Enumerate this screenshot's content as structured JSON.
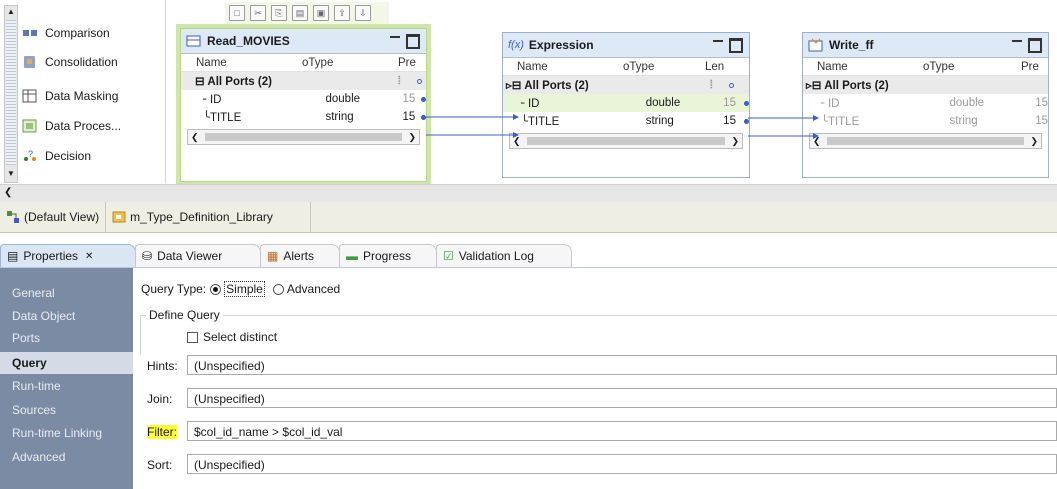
{
  "palette": {
    "items": [
      "Comparison",
      "Consolidation",
      "Data Masking",
      "Data Proces...",
      "Decision"
    ]
  },
  "transforms": {
    "read": {
      "title": "Read_MOVIES",
      "col_name": "Name",
      "col_type": "Type",
      "col_extra": "Pre",
      "group": "All Ports (2)",
      "rows": [
        {
          "name": "ID",
          "type": "double",
          "prec": "15"
        },
        {
          "name": "TITLE",
          "type": "string",
          "prec": "15"
        }
      ]
    },
    "expression": {
      "title": "Expression",
      "col_name": "Name",
      "col_type": "Type",
      "col_extra": "Len",
      "group": "All Ports (2)",
      "rows": [
        {
          "name": "ID",
          "type": "double",
          "prec": "15"
        },
        {
          "name": "TITLE",
          "type": "string",
          "prec": "15"
        }
      ]
    },
    "write": {
      "title": "Write_ff",
      "col_name": "Name",
      "col_type": "Type",
      "col_extra": "Pre",
      "group": "All Ports (2)",
      "rows": [
        {
          "name": "ID",
          "type": "double",
          "prec": "15"
        },
        {
          "name": "TITLE",
          "type": "string",
          "prec": "15"
        }
      ]
    }
  },
  "view_tabs": {
    "default_view": "(Default View)",
    "mapping": "m_Type_Definition_Library"
  },
  "properties_tabs": {
    "properties": "Properties",
    "data_viewer": "Data Viewer",
    "alerts": "Alerts",
    "progress": "Progress",
    "validation_log": "Validation Log"
  },
  "nav": {
    "items": [
      "General",
      "Data Object",
      "Ports",
      "Query",
      "Run-time",
      "Sources",
      "Run-time Linking",
      "Advanced"
    ],
    "active": "Query"
  },
  "query": {
    "query_type_label": "Query Type:",
    "simple_label": "Simple",
    "advanced_label": "Advanced",
    "define_query_label": "Define Query",
    "select_distinct_label": "Select distinct",
    "hints_label": "Hints:",
    "hints_value": "(Unspecified)",
    "join_label": "Join:",
    "join_value": "(Unspecified)",
    "filter_label": "Filter:",
    "filter_value": "$col_id_name > $col_id_val",
    "sort_label": "Sort:",
    "sort_value": "(Unspecified)"
  },
  "colors": {
    "nav_bg": "#7b8ba3",
    "selection_green": "#cfe6a9",
    "link_blue": "#3c5cc8",
    "filter_highlight": "#ffff33"
  }
}
